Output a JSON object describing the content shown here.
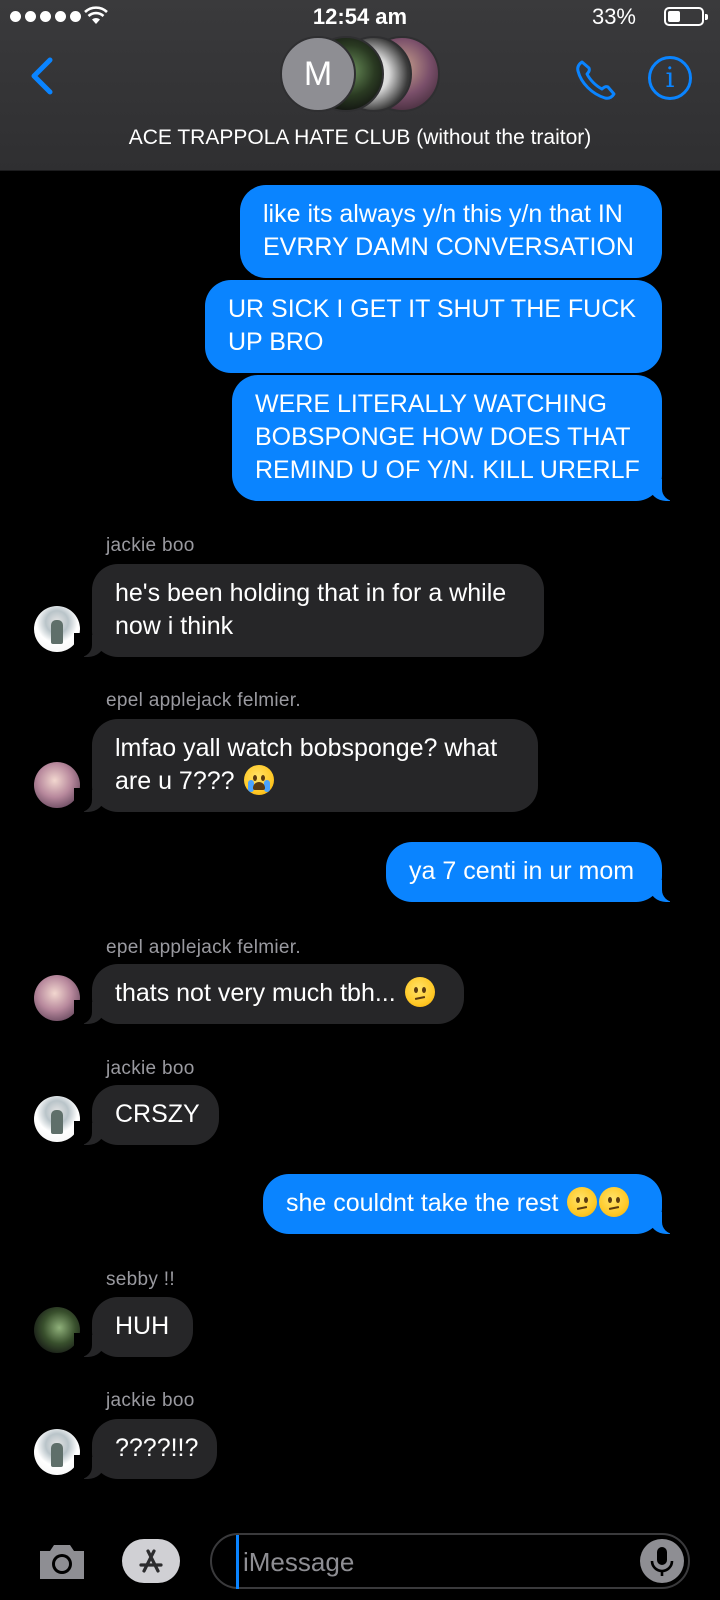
{
  "status_bar": {
    "time": "12:54 am",
    "battery_percent": "33%",
    "battery_level": 0.33
  },
  "header": {
    "avatar_initial": "M",
    "title": "ACE TRAPPOLA HATE CLUB (without the traitor)"
  },
  "messages": [
    {
      "direction": "outgoing",
      "text": "like its always y/n this y/n that IN EVRRY DAMN CONVERSATION"
    },
    {
      "direction": "outgoing",
      "text": "UR SICK I GET IT SHUT THE FUCK UP BRO"
    },
    {
      "direction": "outgoing",
      "text": "WERE LITERALLY WATCHING BOBSPONGE HOW DOES THAT REMIND U OF Y/N. KILL URERLF"
    },
    {
      "direction": "incoming",
      "sender": "jackie boo",
      "text": "he's been holding that in for a while now i think"
    },
    {
      "direction": "incoming",
      "sender": "epel applejack felmier.",
      "text": "lmfao yall watch bobsponge? what are u 7???",
      "emoji": "loudly-crying-face"
    },
    {
      "direction": "outgoing",
      "text": "ya 7 centi in ur mom"
    },
    {
      "direction": "incoming",
      "sender": "epel applejack felmier.",
      "text": "thats not very much tbh...",
      "emoji": "confused-face"
    },
    {
      "direction": "incoming",
      "sender": "jackie boo",
      "text": "CRSZY"
    },
    {
      "direction": "outgoing",
      "text": "she couldnt take the rest",
      "emoji": "confused-face x2"
    },
    {
      "direction": "incoming",
      "sender": "sebby !!",
      "text": "HUH"
    },
    {
      "direction": "incoming",
      "sender": "jackie boo",
      "text": "????!!?"
    }
  ],
  "input": {
    "placeholder": "iMessage"
  },
  "icons": {
    "back": "chevron-left-icon",
    "phone": "phone-icon",
    "info": "info-icon",
    "camera": "camera-icon",
    "apps": "app-store-icon",
    "mic": "microphone-icon"
  },
  "colors": {
    "accent": "#0a84ff",
    "incoming_bubble": "#262628",
    "header_bg": "#343436"
  }
}
